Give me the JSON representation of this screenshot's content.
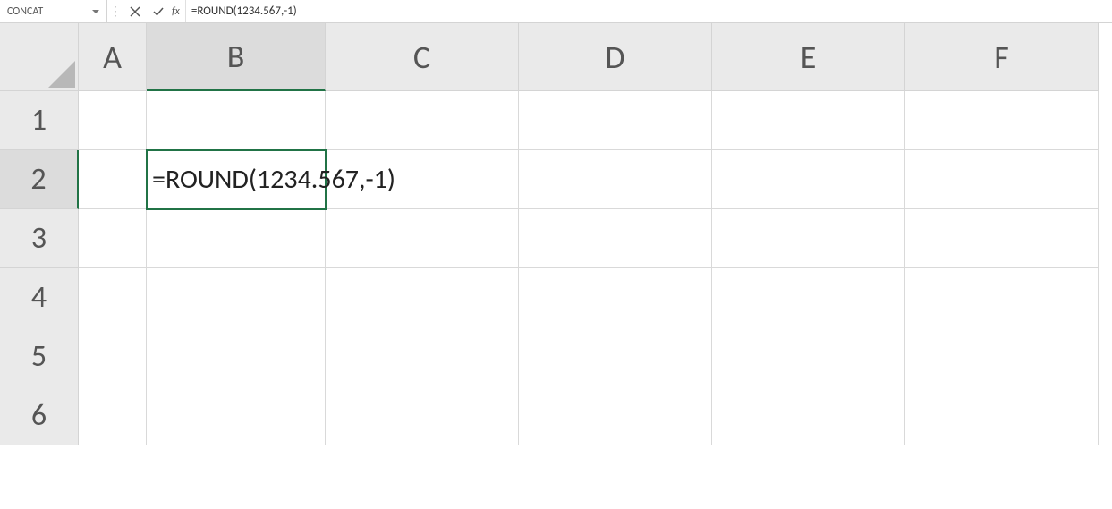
{
  "formulaBar": {
    "nameBox": "CONCAT",
    "cancelTooltip": "Cancel",
    "enterTooltip": "Enter",
    "fxLabel": "fx",
    "formula": "=ROUND(1234.567,-1)"
  },
  "columns": [
    "A",
    "B",
    "C",
    "D",
    "E",
    "F"
  ],
  "rows": [
    "1",
    "2",
    "3",
    "4",
    "5",
    "6"
  ],
  "activeCell": {
    "col": "B",
    "row": "2",
    "editValue": "=ROUND(1234.567,-1)"
  }
}
